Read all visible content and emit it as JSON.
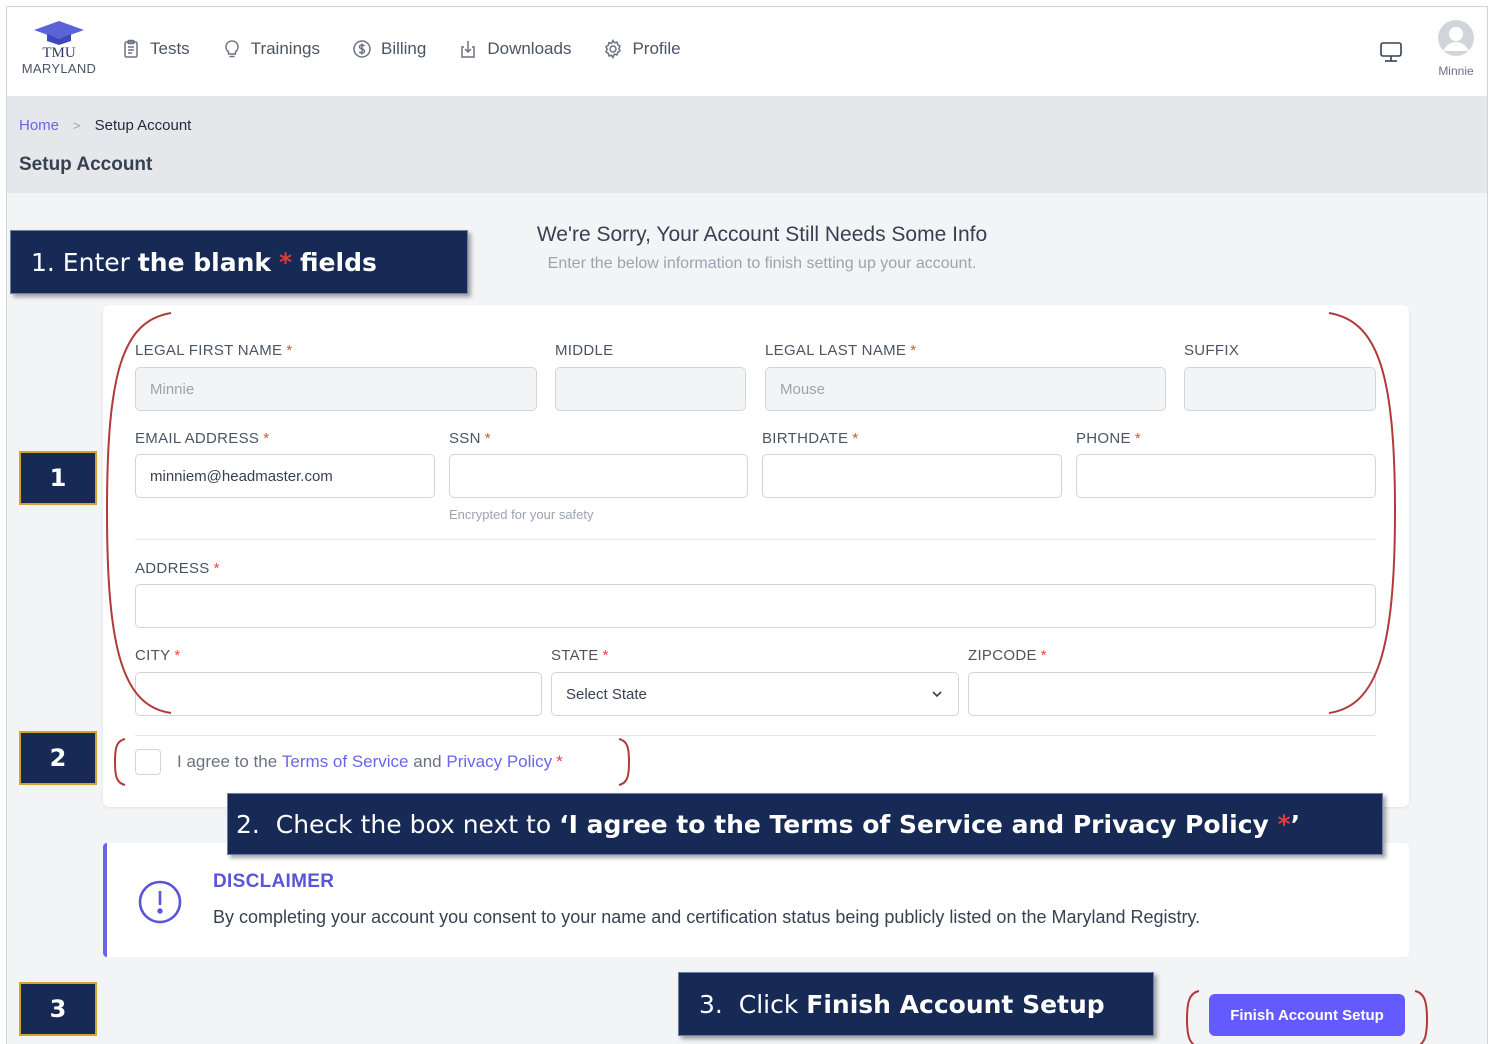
{
  "nav": {
    "logo_top": "TMU",
    "logo_bottom": "MARYLAND",
    "items": [
      {
        "label": "Tests",
        "icon": "clipboard-icon"
      },
      {
        "label": "Trainings",
        "icon": "lightbulb-icon"
      },
      {
        "label": "Billing",
        "icon": "dollar-icon"
      },
      {
        "label": "Downloads",
        "icon": "download-icon"
      },
      {
        "label": "Profile",
        "icon": "gear-icon"
      }
    ],
    "user_name": "Minnie"
  },
  "breadcrumb": {
    "home": "Home",
    "separator": ">",
    "current": "Setup Account"
  },
  "page_title": "Setup Account",
  "intro": {
    "title": "We're Sorry, Your Account Still Needs Some Info",
    "subtitle": "Enter the below information to finish setting up your account."
  },
  "form": {
    "required_mark": "*",
    "legal_first_name": {
      "label": "LEGAL FIRST NAME",
      "value": "Minnie"
    },
    "middle": {
      "label": "MIDDLE",
      "value": ""
    },
    "legal_last_name": {
      "label": "LEGAL LAST NAME",
      "value": "Mouse"
    },
    "suffix": {
      "label": "SUFFIX",
      "value": ""
    },
    "email": {
      "label": "EMAIL ADDRESS",
      "value": "minniem@headmaster.com"
    },
    "ssn": {
      "label": "SSN",
      "value": "",
      "hint": "Encrypted for your safety"
    },
    "birthdate": {
      "label": "BIRTHDATE",
      "value": ""
    },
    "phone": {
      "label": "PHONE",
      "value": ""
    },
    "address": {
      "label": "ADDRESS",
      "value": ""
    },
    "city": {
      "label": "CITY",
      "value": ""
    },
    "state": {
      "label": "STATE",
      "selected": "Select State"
    },
    "zipcode": {
      "label": "ZIPCODE",
      "value": ""
    },
    "agree": {
      "pre": "I agree to the",
      "terms": "Terms of Service",
      "and": "and",
      "privacy": "Privacy Policy"
    }
  },
  "disclaimer": {
    "title": "DISCLAIMER",
    "text": "By completing your account you consent to your name and certification status being publicly listed on the Maryland Registry."
  },
  "finish_button": "Finish Account Setup",
  "callouts": {
    "step1": {
      "pre": "1. Enter ",
      "bold1": "the blank",
      "star": "*",
      "bold2": "fields"
    },
    "step2": {
      "pre": "2.  Check the box next to ",
      "bold": "‘I agree to the Terms of Service and Privacy Policy ",
      "star": "*",
      "end": "’"
    },
    "step3": {
      "pre": "3.  Click ",
      "bold": "Finish Account Setup"
    }
  },
  "step_numbers": [
    "1",
    "2",
    "3"
  ],
  "colors": {
    "accent": "#635bff",
    "callout_bg": "#172a55",
    "bracket": "#b23a3a",
    "required": "#ef4444"
  }
}
